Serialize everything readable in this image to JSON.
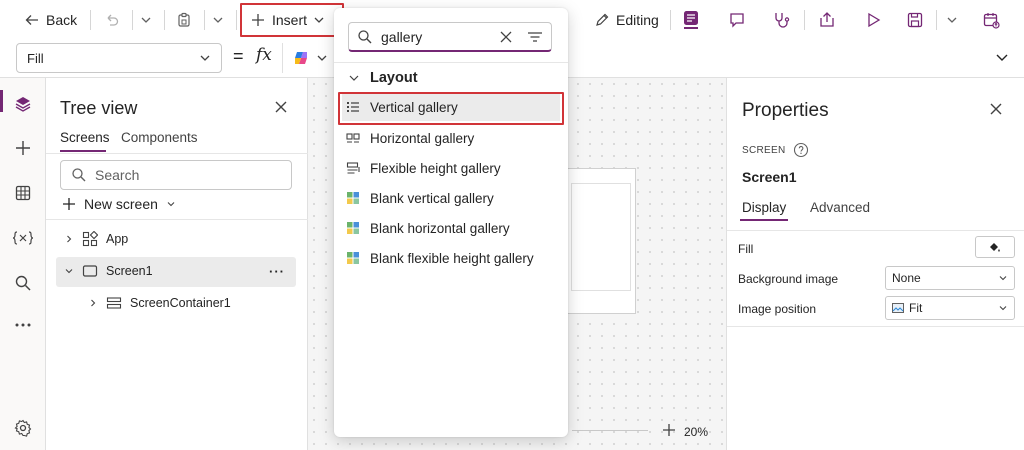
{
  "toolbar": {
    "back_label": "Back",
    "insert_label": "Insert",
    "editing_label": "Editing"
  },
  "formula": {
    "property_value": "Fill",
    "equals": "=",
    "fx": "fx"
  },
  "tree": {
    "title": "Tree view",
    "tabs": [
      "Screens",
      "Components"
    ],
    "search_placeholder": "Search",
    "new_screen_label": "New screen",
    "items": [
      {
        "label": "App"
      },
      {
        "label": "Screen1"
      },
      {
        "label": "ScreenContainer1"
      }
    ],
    "more": "···"
  },
  "dropdown": {
    "search_value": "gallery",
    "section_label": "Layout",
    "items": [
      {
        "label": "Vertical gallery"
      },
      {
        "label": "Horizontal gallery"
      },
      {
        "label": "Flexible height gallery"
      },
      {
        "label": "Blank vertical gallery"
      },
      {
        "label": "Blank horizontal gallery"
      },
      {
        "label": "Blank flexible height gallery"
      }
    ]
  },
  "properties": {
    "title": "Properties",
    "type_label": "SCREEN",
    "screen_name": "Screen1",
    "tabs": [
      "Display",
      "Advanced"
    ],
    "fill_label": "Fill",
    "background_image_label": "Background image",
    "background_image_value": "None",
    "image_position_label": "Image position",
    "image_position_value": "Fit"
  },
  "canvas": {
    "zoom_label": "20%",
    "zoom_plus": "+"
  },
  "colors": {
    "accent": "#742774",
    "highlight": "#d13438"
  }
}
